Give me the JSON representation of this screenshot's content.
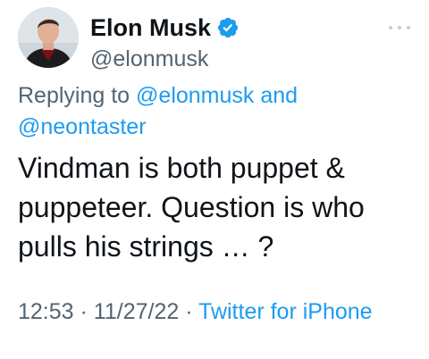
{
  "author": {
    "display_name": "Elon Musk",
    "handle": "@elonmusk",
    "verified": true,
    "avatar_icon": "user-avatar-photo",
    "verified_icon": "verified-badge-icon",
    "more_icon": "more-dots-icon"
  },
  "reply": {
    "prefix": "Replying to",
    "mention_1": "@elonmusk",
    "conjunction": "and",
    "mention_2": "@neontaster"
  },
  "tweet": {
    "text": "Vindman is both puppet & puppeteer. Question is who pulls his strings … ?"
  },
  "meta": {
    "time": "12:53",
    "separator": "·",
    "date": "11/27/22",
    "source": "Twitter for iPhone"
  },
  "colors": {
    "link": "#1d9bf0",
    "secondary_text": "#536471",
    "primary_text": "#0f1419",
    "background": "#ffffff"
  }
}
